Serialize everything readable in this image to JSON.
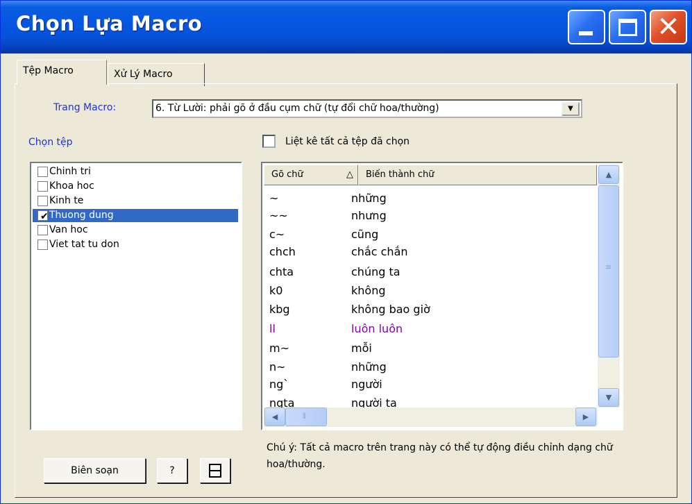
{
  "window": {
    "title": "Chọn Lựa Macro",
    "controls": {
      "minimize": "minimize-icon",
      "maximize": "maximize-icon",
      "close": "close-icon"
    }
  },
  "tabs": [
    {
      "label": "Tệp Macro",
      "active": true
    },
    {
      "label": "Xử Lý Macro",
      "active": false
    }
  ],
  "macro_page": {
    "label": "Trang Macro:",
    "value": "6. Từ Lười: phải gõ ở đầu cụm chữ (tự đổi chữ hoa/thường)"
  },
  "file_section": {
    "label": "Chọn tệp",
    "files": [
      {
        "name": "Chinh tri",
        "checked": false,
        "selected": false
      },
      {
        "name": "Khoa hoc",
        "checked": false,
        "selected": false
      },
      {
        "name": "Kinh te",
        "checked": false,
        "selected": false
      },
      {
        "name": "Thuong dung",
        "checked": true,
        "selected": true
      },
      {
        "name": "Van hoc",
        "checked": false,
        "selected": false
      },
      {
        "name": "Viet tat tu don",
        "checked": false,
        "selected": false
      }
    ]
  },
  "list_all_checkbox": {
    "label": "Liệt kê tất cả tệp đã chọn",
    "checked": false
  },
  "macro_table": {
    "columns": [
      "Gõ chữ",
      "Biến thành chữ"
    ],
    "sort_icon": "△",
    "rows": [
      [
        "~",
        "những"
      ],
      [
        "~~",
        "nhưng"
      ],
      [
        "c~",
        "cũng"
      ],
      [
        "chch",
        "chắc chắn"
      ],
      [
        "chta",
        "chúng ta"
      ],
      [
        "k0",
        "không"
      ],
      [
        "kbg",
        "không bao giờ"
      ],
      [
        "ll",
        "luôn luôn"
      ],
      [
        "m~",
        "mỗi"
      ],
      [
        "n~",
        "những"
      ],
      [
        "ng`",
        "người"
      ],
      [
        "ngta",
        "người ta"
      ]
    ]
  },
  "note": "Chú ý: Tất cả macro trên trang này có thể tự động điều chỉnh dạng chữ hoa/thường.",
  "buttons": {
    "edit": "Biên soạn",
    "help": "?"
  },
  "colors": {
    "title_bar": "#0657e4",
    "selection": "#316ac5",
    "label_blue": "#2233cc",
    "macro_highlight": "#7a0a9c"
  }
}
